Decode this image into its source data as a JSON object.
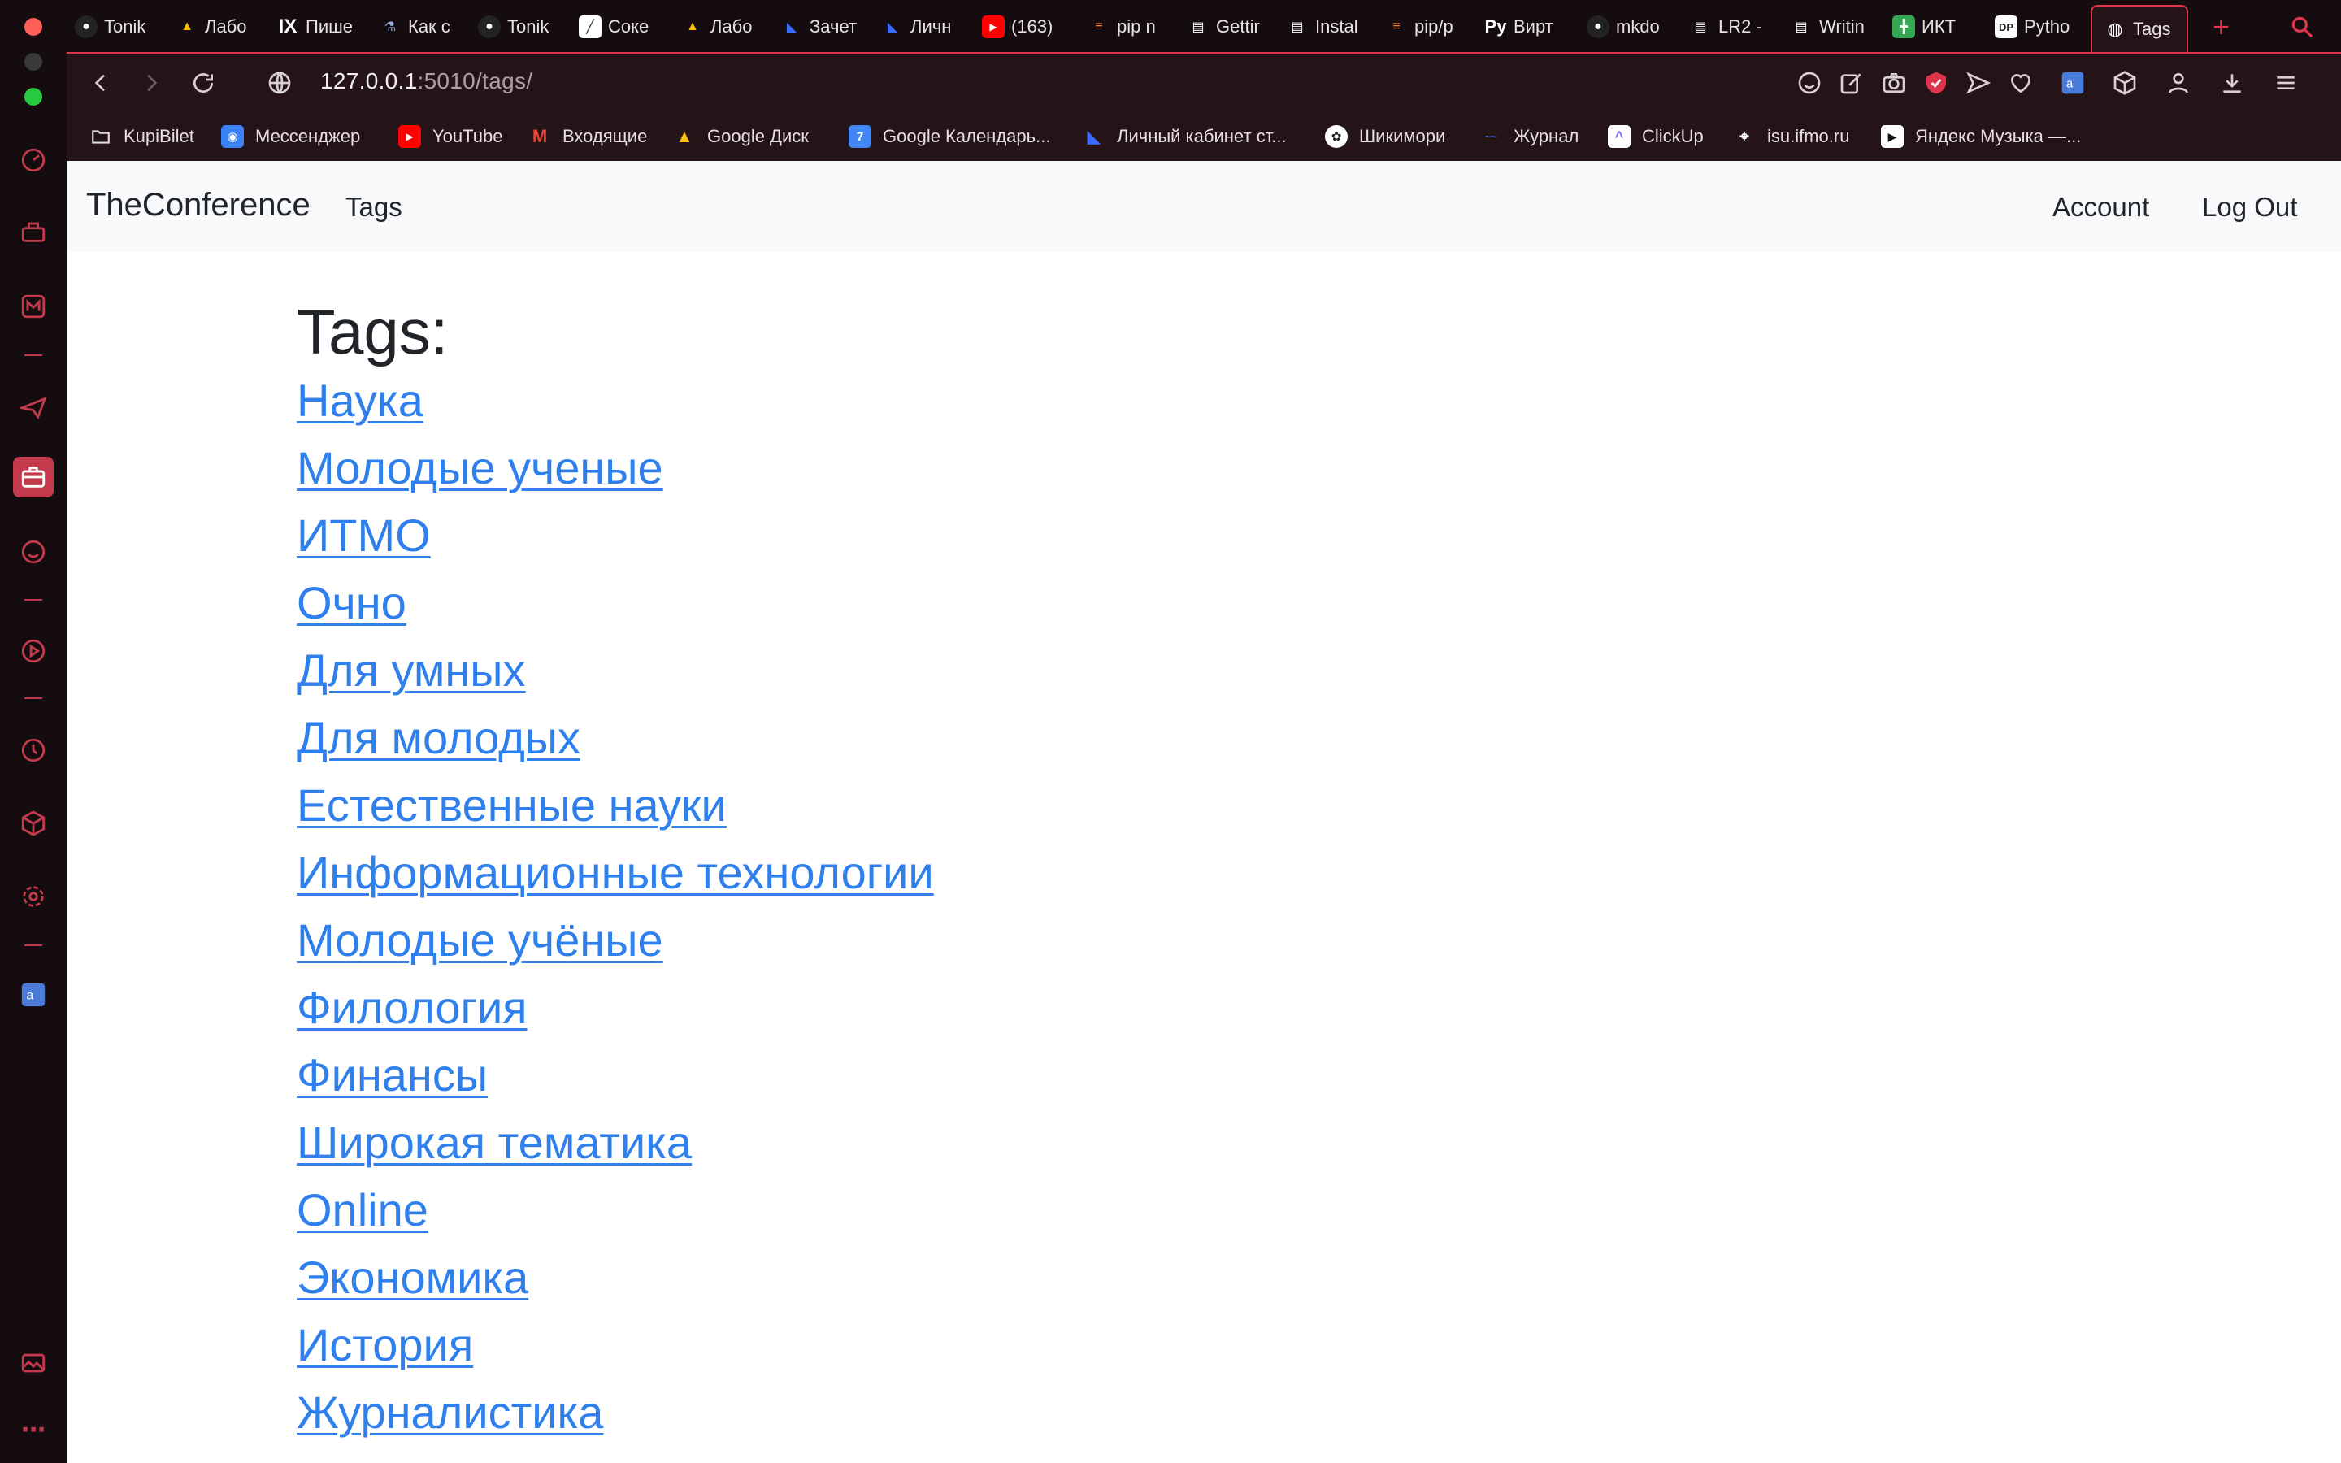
{
  "browser": {
    "tabs": [
      {
        "label": "Tonik",
        "icon": "github-icon",
        "color": "#ffffff"
      },
      {
        "label": "Лабо",
        "icon": "google-drive-icon",
        "color": "#34a853"
      },
      {
        "label": "Пише",
        "icon": "ix-icon",
        "color": "#ffffff"
      },
      {
        "label": "Как с",
        "icon": "bottle-icon",
        "color": "#9ad"
      },
      {
        "label": "Tonik",
        "icon": "github-icon",
        "color": "#ffffff"
      },
      {
        "label": "Соке",
        "icon": "chart-icon",
        "color": "#ffffff"
      },
      {
        "label": "Лабо",
        "icon": "google-drive-icon",
        "color": "#34a853"
      },
      {
        "label": "Зачет",
        "icon": "jetbrains-icon",
        "color": "#3d6bff"
      },
      {
        "label": "Личн",
        "icon": "jetbrains-icon",
        "color": "#3d6bff"
      },
      {
        "label": "(163)",
        "icon": "youtube-icon",
        "color": "#ff0000"
      },
      {
        "label": "pip n",
        "icon": "stackoverflow-icon",
        "color": "#f48024"
      },
      {
        "label": "Gettir",
        "icon": "docs-icon",
        "color": "#ffffff"
      },
      {
        "label": "Instal",
        "icon": "docs-icon",
        "color": "#ffffff"
      },
      {
        "label": "pip/p",
        "icon": "stackoverflow-icon",
        "color": "#f48024"
      },
      {
        "label": "Вирт",
        "icon": "py-icon",
        "color": "#ffffff"
      },
      {
        "label": "mkdo",
        "icon": "github-icon",
        "color": "#ffffff"
      },
      {
        "label": "LR2 -",
        "icon": "docs-icon",
        "color": "#ffffff"
      },
      {
        "label": "Writin",
        "icon": "docs-icon",
        "color": "#ffffff"
      },
      {
        "label": "ИКТ",
        "icon": "sheets-icon",
        "color": "#34a853"
      },
      {
        "label": "Pytho",
        "icon": "dp-icon",
        "color": "#ffffff"
      },
      {
        "label": "Tags",
        "icon": "globe-icon",
        "color": "#ffffff",
        "active": true
      }
    ],
    "new_tab_symbol": "+",
    "url_host": "127.0.0.1",
    "url_path": ":5010/tags/",
    "bookmarks": [
      {
        "label": "KupiBilet",
        "icon": "folder-icon"
      },
      {
        "label": "Мессенджер",
        "icon": "messenger-icon"
      },
      {
        "label": "YouTube",
        "icon": "youtube-icon"
      },
      {
        "label": "Входящие",
        "icon": "gmail-icon"
      },
      {
        "label": "Google Диск",
        "icon": "google-drive-icon"
      },
      {
        "label": "Google Календарь...",
        "icon": "calendar-icon"
      },
      {
        "label": "Личный кабинет ст...",
        "icon": "jetbrains-icon"
      },
      {
        "label": "Шикимори",
        "icon": "shikimori-icon"
      },
      {
        "label": "Журнал",
        "icon": "journal-icon"
      },
      {
        "label": "ClickUp",
        "icon": "clickup-icon"
      },
      {
        "label": "isu.ifmo.ru",
        "icon": "isu-icon"
      },
      {
        "label": "Яндекс Музыка —...",
        "icon": "yandex-music-icon"
      }
    ],
    "accent": "#e0344d"
  },
  "site": {
    "brand": "TheConference",
    "nav_tags": "Tags",
    "nav_account": "Account",
    "nav_logout": "Log Out",
    "heading": "Tags:",
    "link_color": "#2f80ed",
    "tags": [
      "Наука",
      "Молодые ученые",
      "ИТМО",
      "Очно",
      "Для умных",
      "Для молодых",
      "Естественные науки",
      "Информационные технологии",
      "Молодые учёные",
      "Филология",
      "Финансы",
      "Широкая тематика",
      "Online",
      "Экономика",
      "История",
      "Журналистика"
    ]
  }
}
